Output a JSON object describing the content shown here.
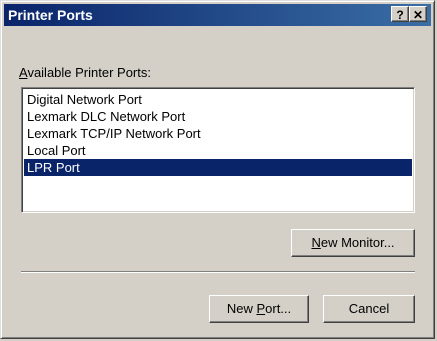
{
  "window": {
    "title": "Printer Ports",
    "help_label": "?",
    "close_label": "✕"
  },
  "ports": {
    "label": "Available Printer Ports:",
    "label_accel": "A",
    "label_rest": "vailable Printer Ports:",
    "items": [
      {
        "label": "Digital Network Port",
        "selected": false
      },
      {
        "label": "Lexmark DLC Network Port",
        "selected": false
      },
      {
        "label": "Lexmark TCP/IP Network Port",
        "selected": false
      },
      {
        "label": "Local Port",
        "selected": false
      },
      {
        "label": "LPR Port",
        "selected": true
      }
    ]
  },
  "buttons": {
    "new_monitor": {
      "label": "New Monitor...",
      "accel": "N",
      "rest": "ew Monitor..."
    },
    "new_port": {
      "label": "New Port...",
      "pre": "New ",
      "accel": "P",
      "rest": "ort..."
    },
    "cancel": {
      "label": "Cancel"
    }
  },
  "colors": {
    "selection": "#0a246a",
    "dialog_face": "#d4d0c8"
  }
}
